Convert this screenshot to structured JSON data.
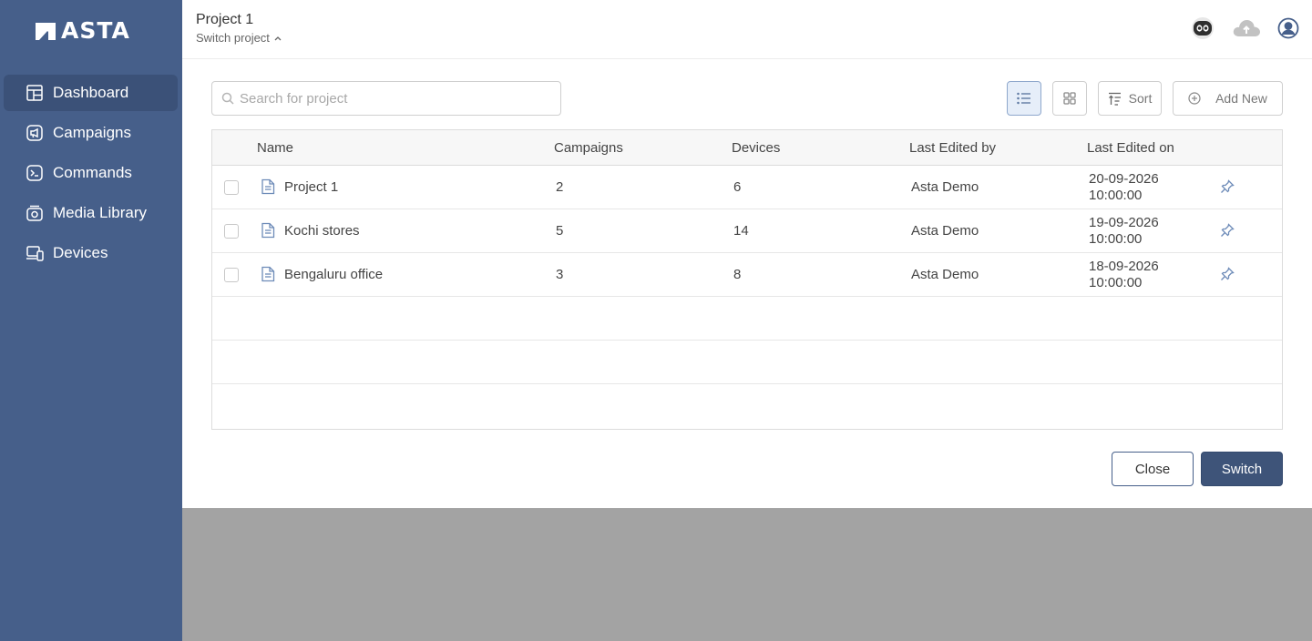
{
  "brand": {
    "name": "ASTA"
  },
  "sidebar": {
    "items": [
      {
        "label": "Dashboard",
        "icon": "dashboard-icon",
        "active": true
      },
      {
        "label": "Campaigns",
        "icon": "megaphone-icon",
        "active": false
      },
      {
        "label": "Commands",
        "icon": "terminal-icon",
        "active": false
      },
      {
        "label": "Media Library",
        "icon": "media-library-icon",
        "active": false
      },
      {
        "label": "Devices",
        "icon": "devices-icon",
        "active": false
      }
    ]
  },
  "header": {
    "project_title": "Project 1",
    "switch_label": "Switch project"
  },
  "toolbar": {
    "search_placeholder": "Search for project",
    "sort_label": "Sort",
    "add_label": "Add New"
  },
  "table": {
    "columns": [
      "Name",
      "Campaigns",
      "Devices",
      "Last Edited by",
      "Last Edited on"
    ],
    "rows": [
      {
        "name": "Project 1",
        "campaigns": "2",
        "devices": "6",
        "edited_by": "Asta Demo",
        "date": "20-09-2026",
        "time": "10:00:00"
      },
      {
        "name": "Kochi stores",
        "campaigns": "5",
        "devices": "14",
        "edited_by": "Asta Demo",
        "date": "19-09-2026",
        "time": "10:00:00"
      },
      {
        "name": "Bengaluru office",
        "campaigns": "3",
        "devices": "8",
        "edited_by": "Asta Demo",
        "date": "18-09-2026",
        "time": "10:00:00"
      }
    ]
  },
  "actions": {
    "close_label": "Close",
    "switch_label": "Switch"
  },
  "colors": {
    "sidebar": "#465f8a",
    "sidebar_active": "#3b5178",
    "primary": "#3e5479",
    "overlay": "#a3a3a3"
  }
}
